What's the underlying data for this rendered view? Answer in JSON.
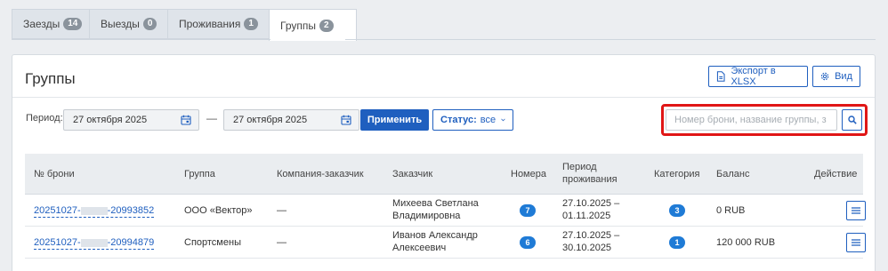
{
  "tabs": [
    {
      "label": "Заезды",
      "count": "14"
    },
    {
      "label": "Выезды",
      "count": "0"
    },
    {
      "label": "Проживания",
      "count": "1"
    },
    {
      "label": "Группы",
      "count": "2"
    }
  ],
  "panel": {
    "title": "Группы",
    "export_label": "Экспорт в XLSX",
    "view_label": "Вид"
  },
  "filters": {
    "period_label": "Период:",
    "date_from": "27 октября 2025",
    "date_to": "27 октября 2025",
    "dash": "—",
    "apply_label": "Применить",
    "status_label": "Статус:",
    "status_value": "все",
    "search_placeholder": "Номер брони, название группы, з"
  },
  "table": {
    "columns": [
      "№ брони",
      "Группа",
      "Компания-заказчик",
      "Заказчик",
      "Номера",
      "Период проживания",
      "Категория",
      "Баланс",
      "Действие"
    ],
    "rows": [
      {
        "booking_prefix": "20251027-",
        "booking_suffix": "-20993852",
        "group": "ООО «Вектор»",
        "company": "—",
        "customer_line1": "Михеева Светлана",
        "customer_line2": "Владимировна",
        "rooms": "7",
        "period_line1": "27.10.2025 –",
        "period_line2": "01.11.2025",
        "category": "3",
        "balance": "0 RUB"
      },
      {
        "booking_prefix": "20251027-",
        "booking_suffix": "-20994879",
        "group": "Спортсмены",
        "company": "—",
        "customer_line1": "Иванов Александр",
        "customer_line2": "Алексеевич",
        "rooms": "6",
        "period_line1": "27.10.2025 –",
        "period_line2": "30.10.2025",
        "category": "1",
        "balance": "120 000 RUB"
      }
    ]
  },
  "colors": {
    "accent": "#1f5fbf",
    "highlight": "#e01616",
    "pill": "#1f7bd6"
  }
}
